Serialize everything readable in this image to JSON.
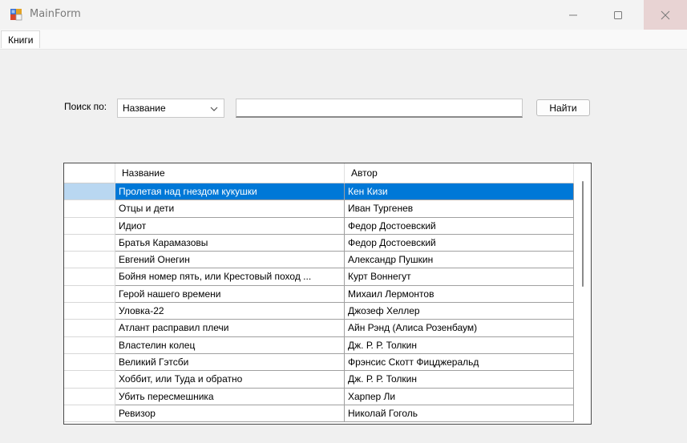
{
  "window": {
    "title": "MainForm"
  },
  "menu": {
    "items": [
      {
        "label": "Книги"
      }
    ]
  },
  "search": {
    "label": "Поиск по:",
    "field_selected": "Название",
    "query": "",
    "button_label": "Найти"
  },
  "table": {
    "columns": [
      "Название",
      "Автор"
    ],
    "rows": [
      {
        "title": "Пролетая над гнездом кукушки",
        "author": "Кен Кизи",
        "selected": true
      },
      {
        "title": "Отцы и дети",
        "author": "Иван Тургенев"
      },
      {
        "title": "Идиот",
        "author": "Федор Достоевский"
      },
      {
        "title": "Братья Карамазовы",
        "author": "Федор Достоевский"
      },
      {
        "title": "Евгений Онегин",
        "author": "Александр Пушкин"
      },
      {
        "title": "Бойня номер пять, или Крестовый поход ...",
        "author": "Курт Воннегут"
      },
      {
        "title": "Герой нашего времени",
        "author": "Михаил Лермонтов"
      },
      {
        "title": "Уловка-22",
        "author": "Джозеф Хеллер"
      },
      {
        "title": "Атлант расправил плечи",
        "author": "Айн Рэнд (Алиса Розенбаум)"
      },
      {
        "title": "Властелин колец",
        "author": "Дж. Р. Р. Толкин"
      },
      {
        "title": "Великий Гэтсби",
        "author": "Фрэнсис Скотт Фицджеральд"
      },
      {
        "title": "Хоббит, или Туда и обратно",
        "author": "Дж. Р. Р. Толкин"
      },
      {
        "title": "Убить пересмешника",
        "author": "Харпер Ли"
      },
      {
        "title": "Ревизор",
        "author": "Николай Гоголь"
      }
    ]
  },
  "colors": {
    "selection": "#0078d7",
    "row_header_selection": "#b9d7f1",
    "close_hover": "#e8d3d3"
  }
}
